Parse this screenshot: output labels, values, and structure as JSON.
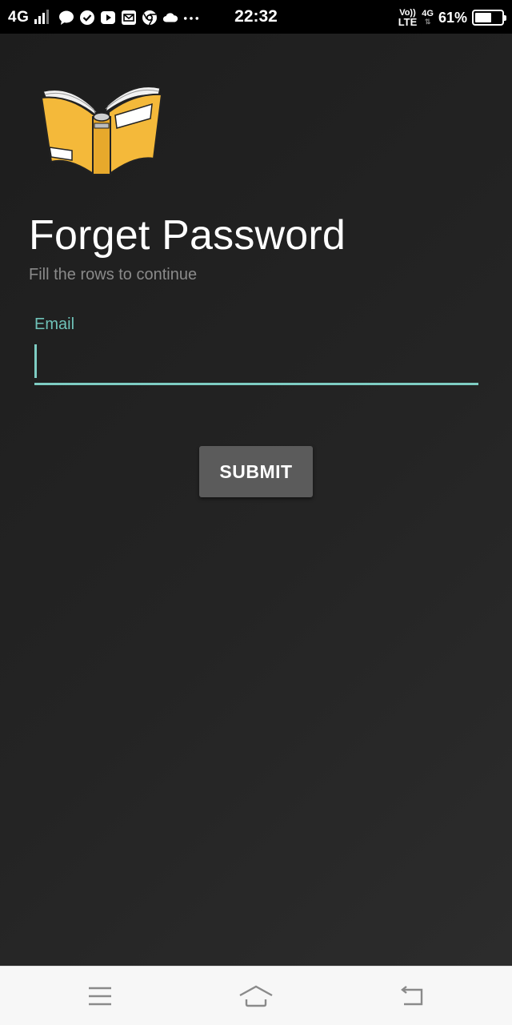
{
  "status_bar": {
    "network": "4G",
    "time": "22:32",
    "volte_top": "Vo))",
    "volte_bottom": "LTE",
    "net_badge": "4G",
    "battery_pct": "61%",
    "battery_level": 0.61,
    "notification_icons": [
      "chat-icon",
      "check-circle-icon",
      "play-icon",
      "mail-icon",
      "chrome-icon",
      "cloud-icon",
      "more-dots-icon"
    ]
  },
  "screen": {
    "title": "Forget Password",
    "subtitle": "Fill the rows to continue",
    "email": {
      "label": "Email",
      "value": ""
    },
    "submit_label": "SUBMIT"
  },
  "nav_bar": {
    "items": [
      "menu-icon",
      "home-icon",
      "back-icon"
    ]
  },
  "colors": {
    "accent": "#7ecdc3",
    "label": "#6fc2b8",
    "background": "#242424",
    "button": "#5b5b5b",
    "book": "#f4b93a"
  }
}
